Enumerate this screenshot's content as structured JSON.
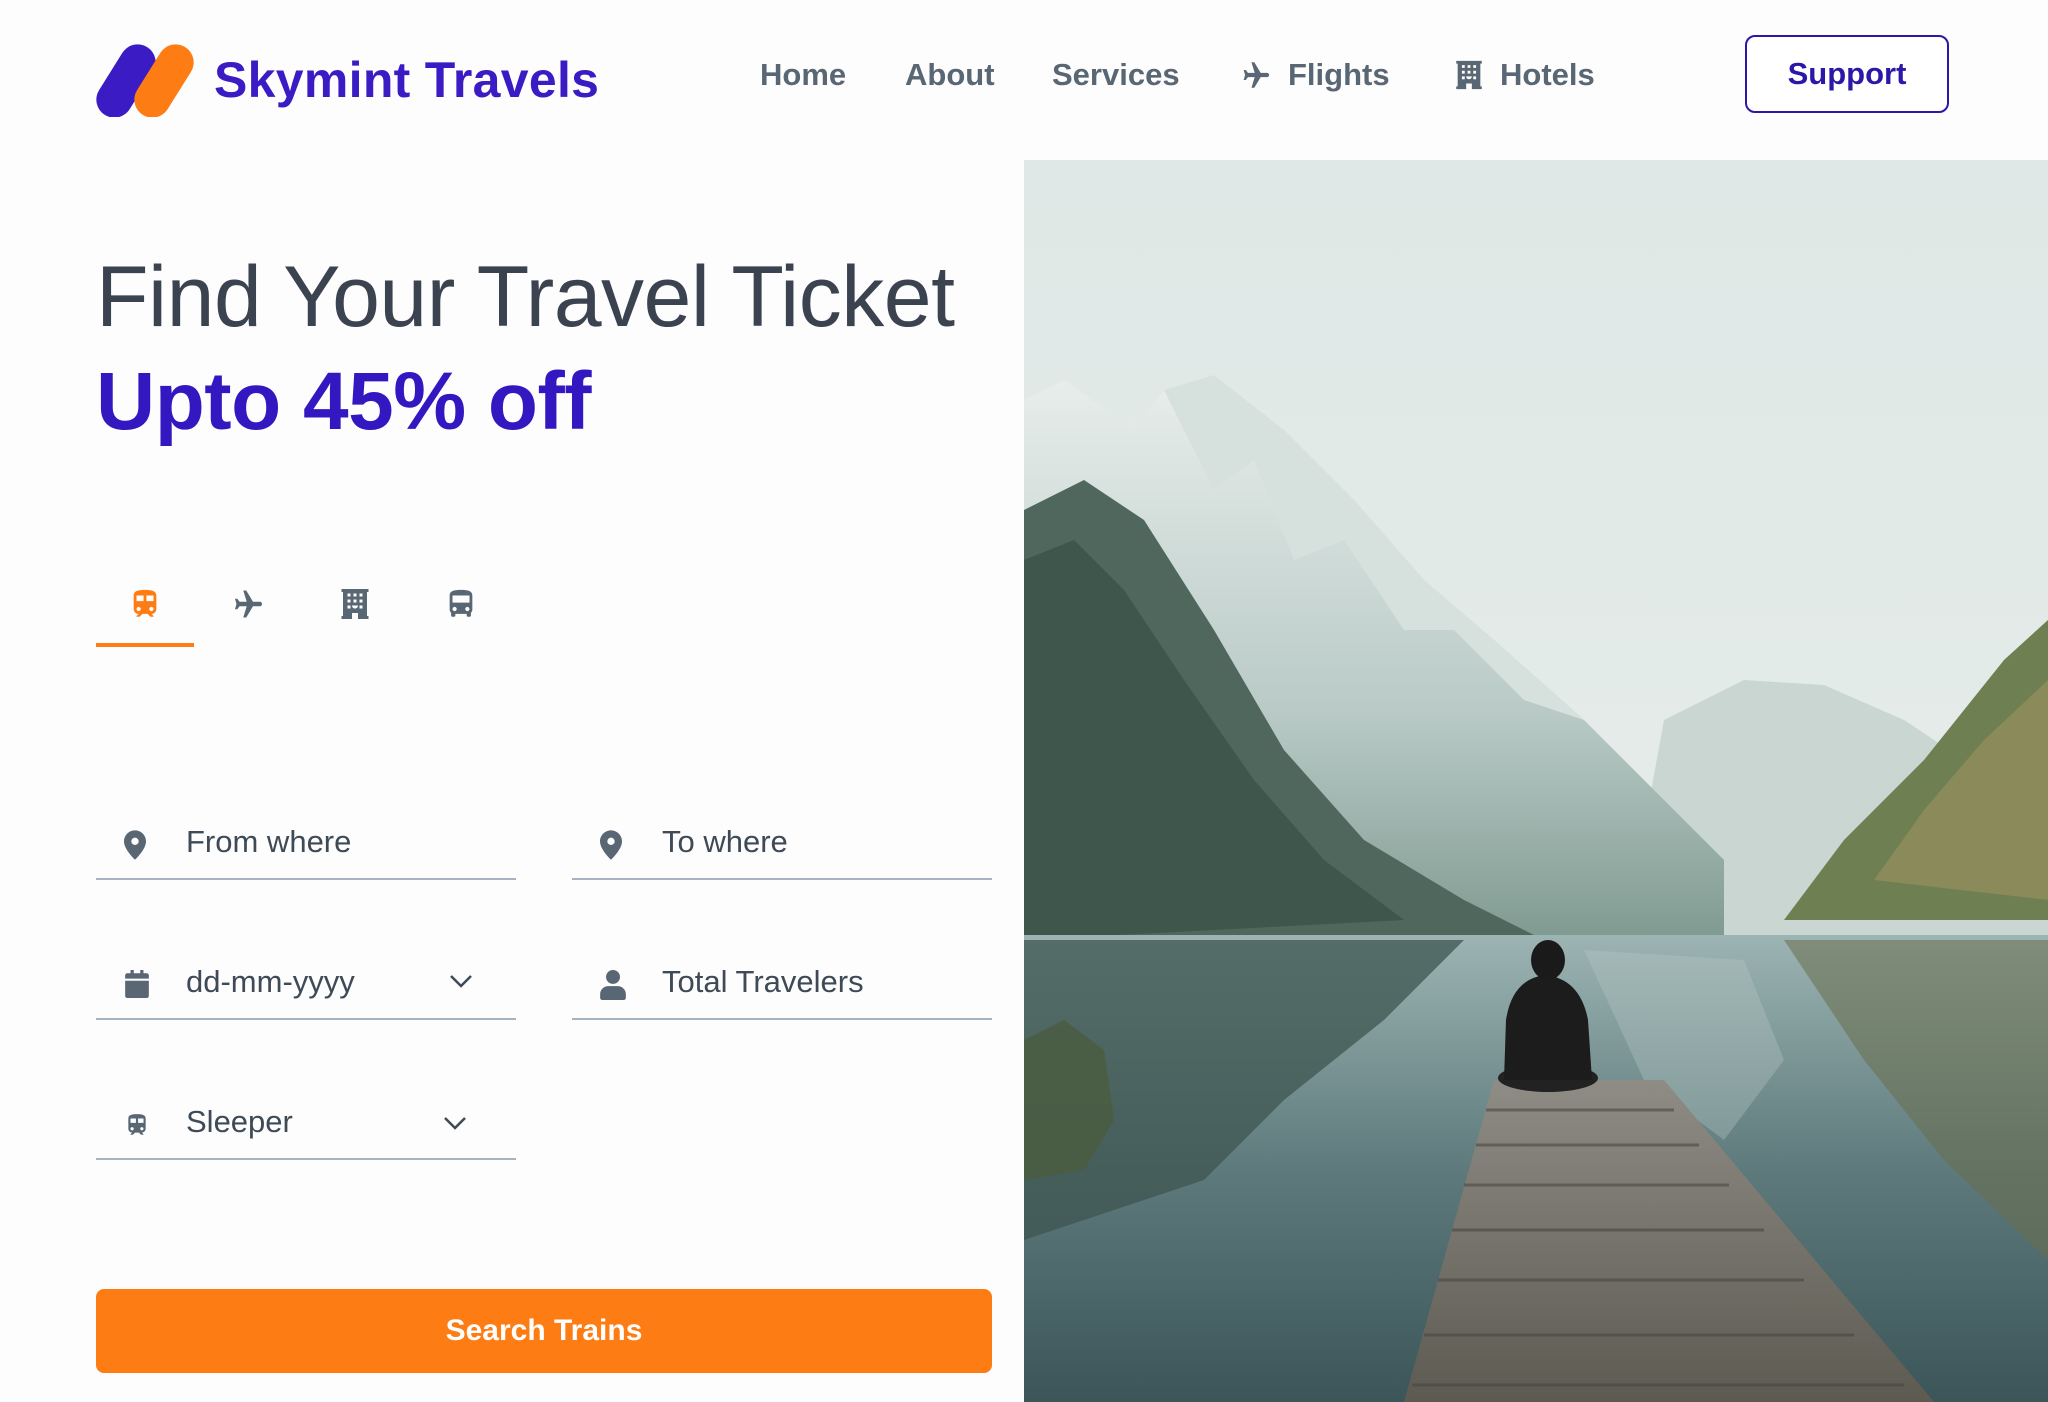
{
  "brand": {
    "name": "Skymint Travels",
    "primary_color": "#3a1bc4",
    "accent_color": "#fd7c14"
  },
  "nav": {
    "items": [
      {
        "label": "Home",
        "icon": ""
      },
      {
        "label": "About",
        "icon": ""
      },
      {
        "label": "Services",
        "icon": ""
      },
      {
        "label": "Flights",
        "icon": "plane-icon"
      },
      {
        "label": "Hotels",
        "icon": "hotel-icon"
      }
    ],
    "support_label": "Support"
  },
  "hero": {
    "title": "Find Your Travel Ticket",
    "subtitle": "Upto 45% off"
  },
  "tabs": [
    {
      "name": "train",
      "icon": "train-icon",
      "active": true
    },
    {
      "name": "flight",
      "icon": "plane-icon",
      "active": false
    },
    {
      "name": "hotel",
      "icon": "hotel-icon",
      "active": false
    },
    {
      "name": "bus",
      "icon": "bus-icon",
      "active": false
    }
  ],
  "form": {
    "from_placeholder": "From where",
    "to_placeholder": "To where",
    "date_placeholder": "dd-mm-yyyy",
    "travelers_placeholder": "Total Travelers",
    "class_value": "Sleeper"
  },
  "search_button_label": "Search Trains"
}
